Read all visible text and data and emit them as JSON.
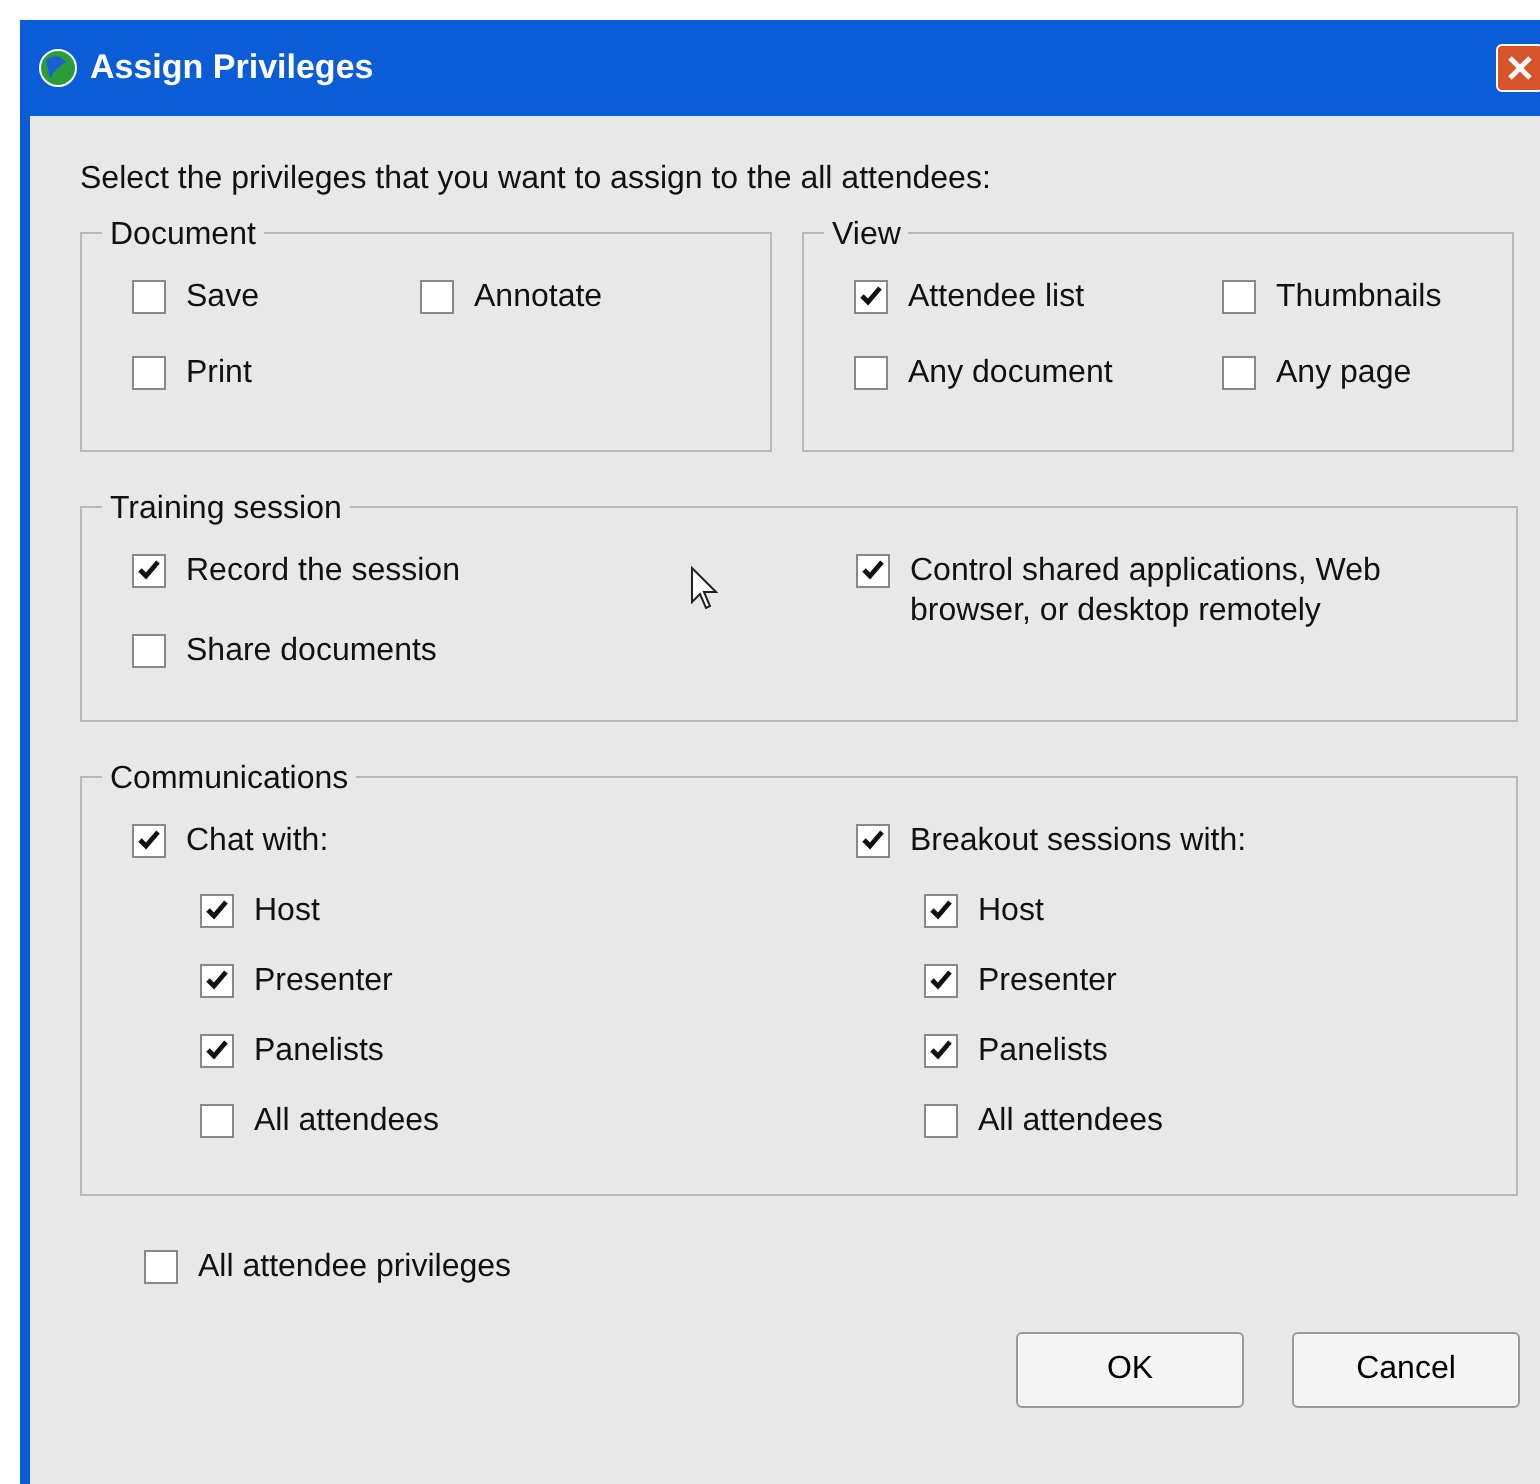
{
  "window": {
    "title": "Assign Privileges"
  },
  "intro": "Select the privileges that you want to assign to the all attendees:",
  "groups": [
    {
      "title": "Document",
      "columns": [
        [
          {
            "label": "Save",
            "checked": false
          },
          {
            "label": "Print",
            "checked": false
          }
        ],
        [
          {
            "label": "Annotate",
            "checked": false
          }
        ]
      ]
    },
    {
      "title": "View",
      "columns": [
        [
          {
            "label": "Attendee list",
            "checked": true
          },
          {
            "label": "Any document",
            "checked": false
          }
        ],
        [
          {
            "label": "Thumbnails",
            "checked": false
          },
          {
            "label": "Any page",
            "checked": false
          }
        ]
      ]
    },
    {
      "title": "Training session",
      "columns": [
        [
          {
            "label": "Record the session",
            "checked": true
          },
          {
            "label": "Share documents",
            "checked": false
          }
        ],
        [
          {
            "label": "Control shared applications, Web browser, or desktop remotely",
            "checked": true
          }
        ]
      ]
    },
    {
      "title": "Communications",
      "columns": [
        [
          {
            "label": "Chat with:",
            "checked": true,
            "children": [
              {
                "label": "Host",
                "checked": true
              },
              {
                "label": "Presenter",
                "checked": true
              },
              {
                "label": "Panelists",
                "checked": true
              },
              {
                "label": "All attendees",
                "checked": false
              }
            ]
          }
        ],
        [
          {
            "label": "Breakout sessions with:",
            "checked": true,
            "children": [
              {
                "label": "Host",
                "checked": true
              },
              {
                "label": "Presenter",
                "checked": true
              },
              {
                "label": "Panelists",
                "checked": true
              },
              {
                "label": "All attendees",
                "checked": false
              }
            ]
          }
        ]
      ]
    }
  ],
  "all_privileges": {
    "label": "All attendee privileges",
    "checked": false
  },
  "buttons": [
    "OK",
    "Cancel"
  ]
}
